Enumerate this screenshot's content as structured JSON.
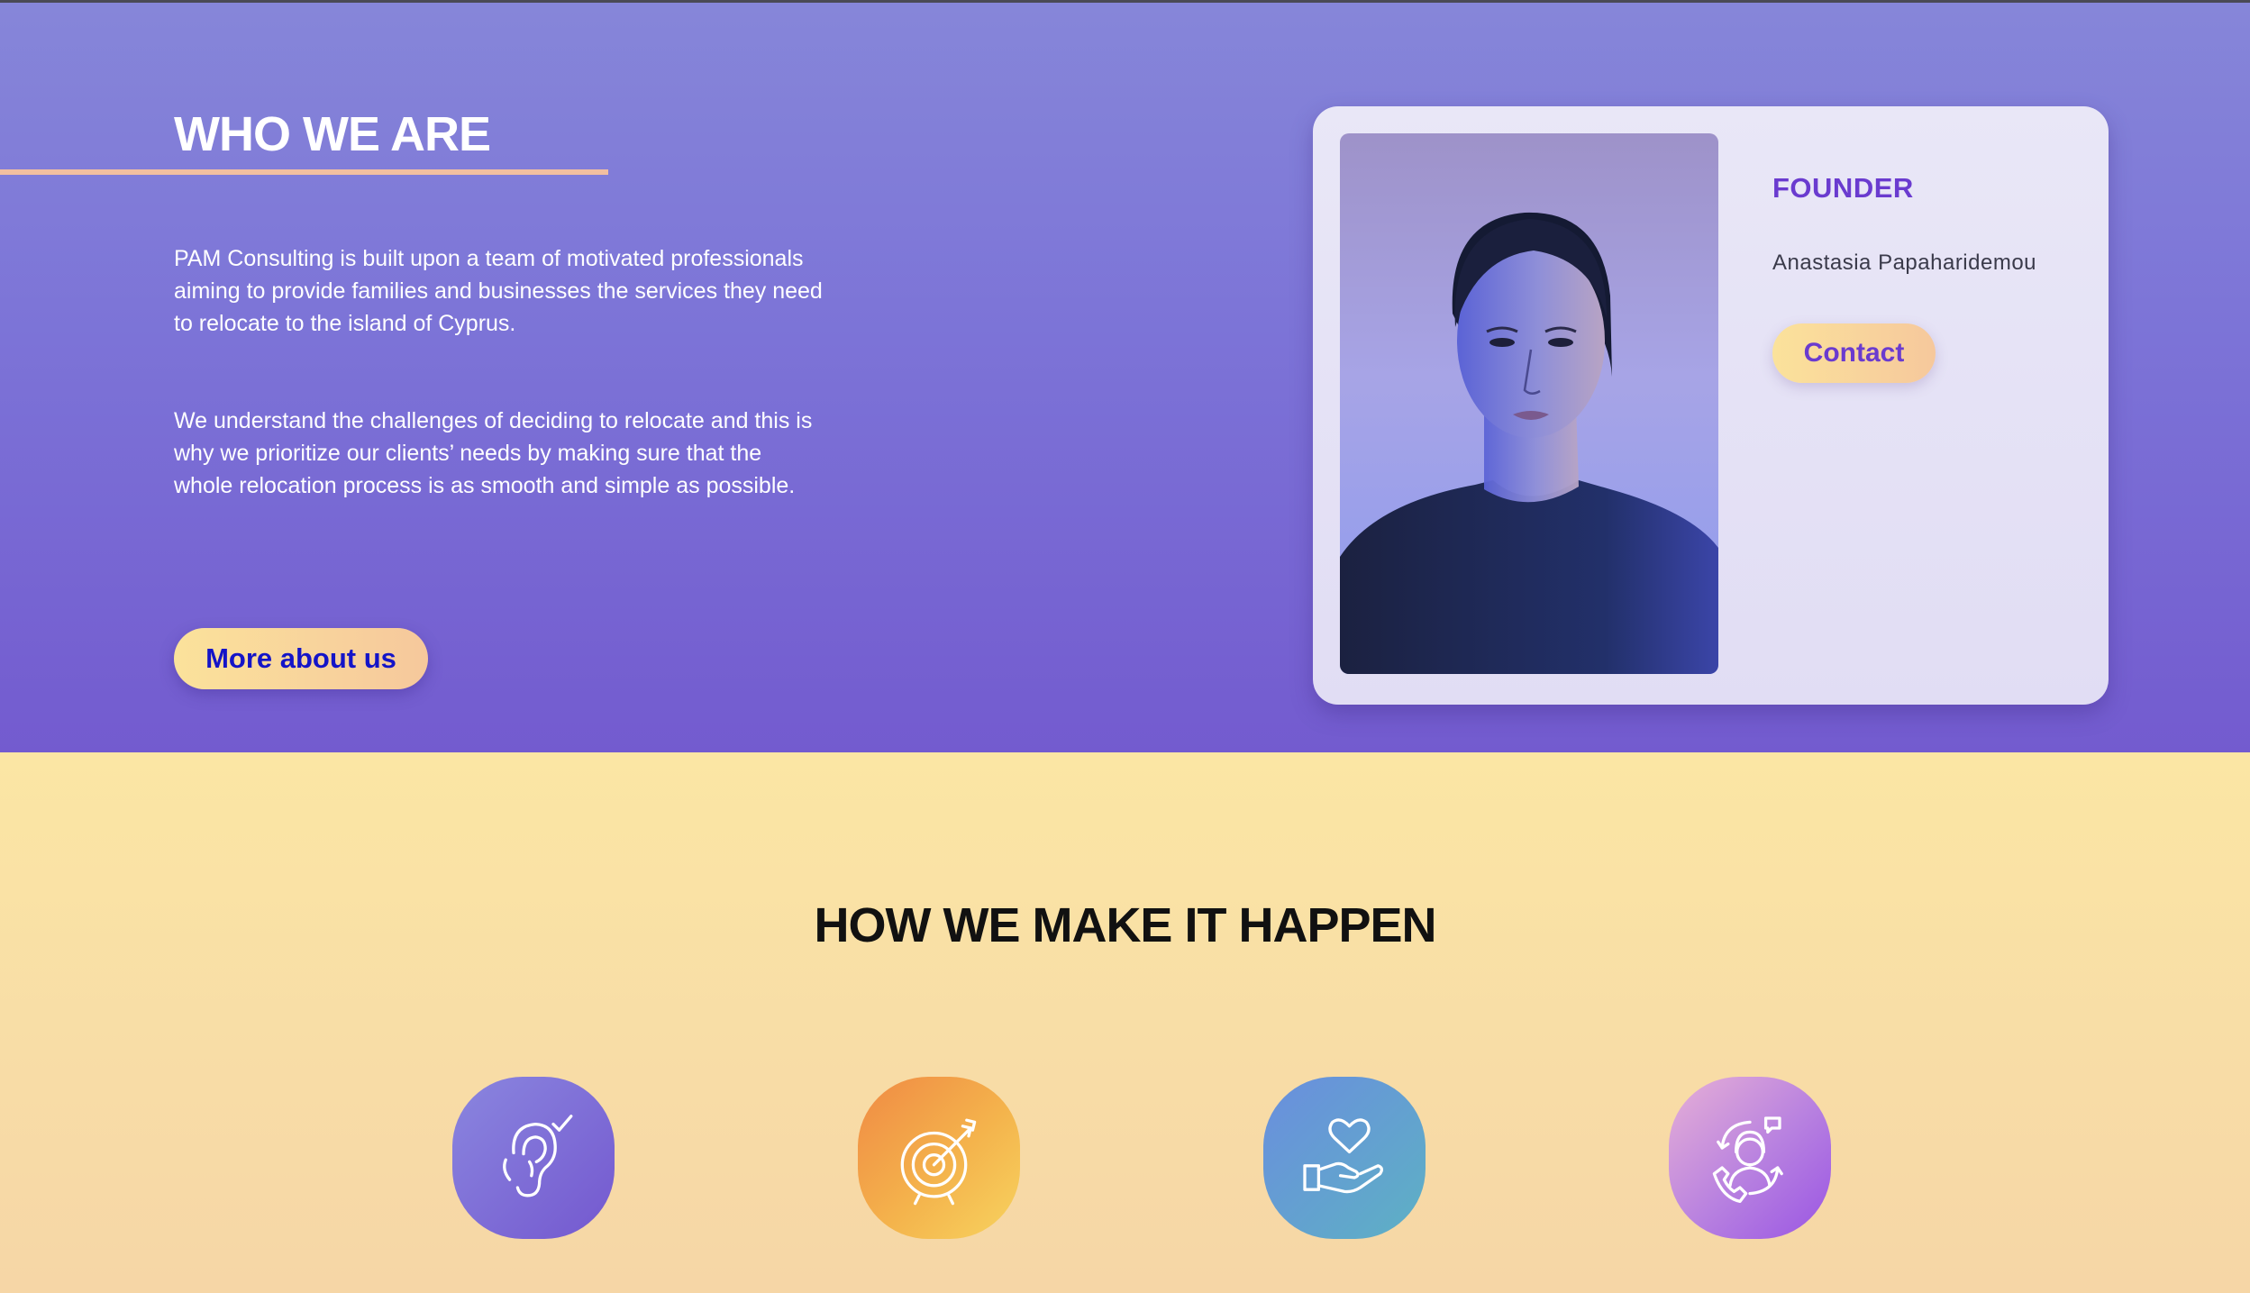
{
  "who": {
    "title": "WHO WE ARE",
    "paragraphs": [
      "PAM Consulting is built upon a team of motivated professionals aiming to provide families and businesses the services they need to relocate to the island of Cyprus.",
      "We understand the challenges of deciding to relocate and this is why we prioritize our clients’ needs by making sure that the whole relocation process is as smooth and simple as possible."
    ],
    "more_button": "More about us"
  },
  "founder": {
    "label": "FOUNDER",
    "name": "Anastasia Papaharidemou",
    "contact_button": "Contact"
  },
  "how": {
    "title": "HOW WE MAKE IT HAPPEN",
    "icons": [
      {
        "icon": "ear-check-icon",
        "color_from": "#8a86df",
        "color_to": "#7458cf"
      },
      {
        "icon": "target-arrow-icon",
        "color_from": "#f08a44",
        "color_to": "#f7d35f"
      },
      {
        "icon": "heart-hand-icon",
        "color_from": "#6a8ede",
        "color_to": "#5db1c4"
      },
      {
        "icon": "support-agent-icon",
        "color_from": "#e7b0d6",
        "color_to": "#9a55e3"
      }
    ]
  },
  "colors": {
    "primary_purple": "#735bcf",
    "accent_yellow": "#fbe29b",
    "link_blue": "#1414c8",
    "founder_purple": "#6a3bcf"
  }
}
